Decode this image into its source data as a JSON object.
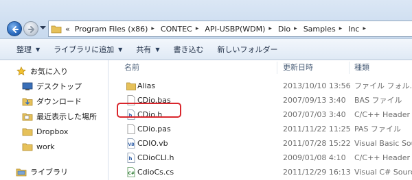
{
  "address_bar": {
    "overflow": "«",
    "crumbs": [
      "Program Files (x86)",
      "CONTEC",
      "API-USBP(WDM)",
      "Dio",
      "Samples",
      "Inc"
    ]
  },
  "toolbar": {
    "organize": "整理",
    "include_in_library": "ライブラリに追加",
    "share": "共有",
    "burn": "書き込む",
    "new_folder": "新しいフォルダー"
  },
  "nav_pane": {
    "favorites": "お気に入り",
    "desktop": "デスクトップ",
    "downloads": "ダウンロード",
    "recent": "最近表示した場所",
    "dropbox": "Dropbox",
    "work": "work",
    "libraries": "ライブラリ"
  },
  "columns": {
    "name": "名前",
    "date": "更新日時",
    "type": "種類"
  },
  "files": [
    {
      "name": "Alias",
      "date": "2013/10/10 13:56",
      "type": "ファイル フォル...",
      "icon": "folder-icon"
    },
    {
      "name": "CDio.bas",
      "date": "2007/09/13 3:40",
      "type": "BAS ファイル",
      "icon": "file-icon"
    },
    {
      "name": "CDio.h",
      "date": "2007/07/03 3:40",
      "type": "C/C++ Header",
      "icon": "c-header-icon"
    },
    {
      "name": "CDio.pas",
      "date": "2011/11/22 11:25",
      "type": "PAS ファイル",
      "icon": "file-icon"
    },
    {
      "name": "CDIO.vb",
      "date": "2011/07/28 15:22",
      "type": "Visual Basic Sour",
      "icon": "vb-file-icon"
    },
    {
      "name": "CDioCLI.h",
      "date": "2009/01/08 4:10",
      "type": "C/C++ Header",
      "icon": "c-header-icon"
    },
    {
      "name": "CdioCs.cs",
      "date": "2011/12/29 16:13",
      "type": "Visual C# Source",
      "icon": "cs-file-icon"
    }
  ],
  "colors": {
    "highlight": "#d9262c",
    "toolbar": "#dfe9f5",
    "address_bg": "#c7d9ee"
  }
}
